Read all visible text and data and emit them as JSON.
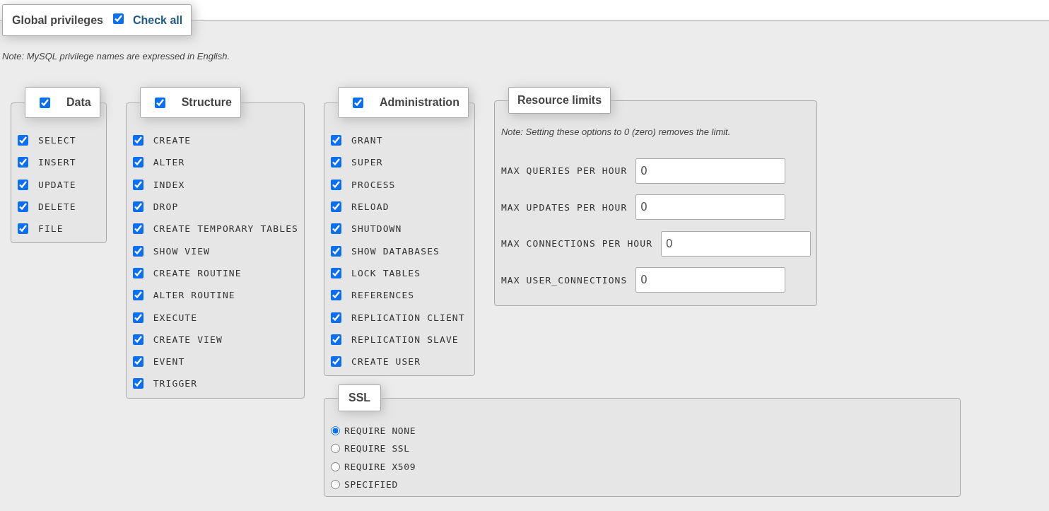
{
  "header": {
    "title": "Global privileges",
    "check_all": {
      "label": "Check all",
      "checked": true
    }
  },
  "note": "Note: MySQL privilege names are expressed in English.",
  "groups": [
    {
      "title": "Data",
      "checked": true,
      "items": [
        {
          "label": "SELECT",
          "checked": true
        },
        {
          "label": "INSERT",
          "checked": true
        },
        {
          "label": "UPDATE",
          "checked": true
        },
        {
          "label": "DELETE",
          "checked": true
        },
        {
          "label": "FILE",
          "checked": true
        }
      ]
    },
    {
      "title": "Structure",
      "checked": true,
      "items": [
        {
          "label": "CREATE",
          "checked": true
        },
        {
          "label": "ALTER",
          "checked": true
        },
        {
          "label": "INDEX",
          "checked": true
        },
        {
          "label": "DROP",
          "checked": true
        },
        {
          "label": "CREATE TEMPORARY TABLES",
          "checked": true
        },
        {
          "label": "SHOW VIEW",
          "checked": true
        },
        {
          "label": "CREATE ROUTINE",
          "checked": true
        },
        {
          "label": "ALTER ROUTINE",
          "checked": true
        },
        {
          "label": "EXECUTE",
          "checked": true
        },
        {
          "label": "CREATE VIEW",
          "checked": true
        },
        {
          "label": "EVENT",
          "checked": true
        },
        {
          "label": "TRIGGER",
          "checked": true
        }
      ]
    },
    {
      "title": "Administration",
      "checked": true,
      "items": [
        {
          "label": "GRANT",
          "checked": true
        },
        {
          "label": "SUPER",
          "checked": true
        },
        {
          "label": "PROCESS",
          "checked": true
        },
        {
          "label": "RELOAD",
          "checked": true
        },
        {
          "label": "SHUTDOWN",
          "checked": true
        },
        {
          "label": "SHOW DATABASES",
          "checked": true
        },
        {
          "label": "LOCK TABLES",
          "checked": true
        },
        {
          "label": "REFERENCES",
          "checked": true
        },
        {
          "label": "REPLICATION CLIENT",
          "checked": true
        },
        {
          "label": "REPLICATION SLAVE",
          "checked": true
        },
        {
          "label": "CREATE USER",
          "checked": true
        }
      ]
    }
  ],
  "resource_limits": {
    "title": "Resource limits",
    "note": "Note: Setting these options to 0 (zero) removes the limit.",
    "fields": [
      {
        "label": "MAX QUERIES PER HOUR",
        "value": "0"
      },
      {
        "label": "MAX UPDATES PER HOUR",
        "value": "0"
      },
      {
        "label": "MAX CONNECTIONS PER HOUR",
        "value": "0"
      },
      {
        "label": "MAX USER_CONNECTIONS",
        "value": "0"
      }
    ]
  },
  "ssl": {
    "title": "SSL",
    "options": [
      {
        "label": "REQUIRE NONE",
        "selected": true
      },
      {
        "label": "REQUIRE SSL",
        "selected": false
      },
      {
        "label": "REQUIRE X509",
        "selected": false
      },
      {
        "label": "SPECIFIED",
        "selected": false
      }
    ]
  }
}
